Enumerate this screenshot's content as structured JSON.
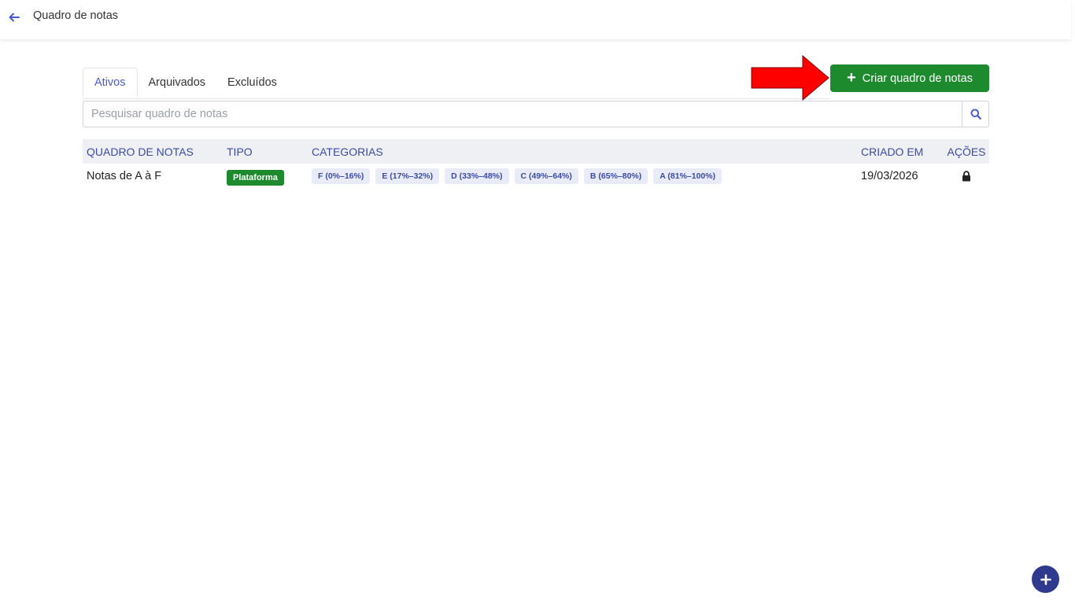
{
  "header": {
    "title": "Quadro de notas"
  },
  "tabs": [
    {
      "label": "Ativos",
      "active": true
    },
    {
      "label": "Arquivados",
      "active": false
    },
    {
      "label": "Excluídos",
      "active": false
    }
  ],
  "actions": {
    "create_label": "Criar quadro de notas"
  },
  "search": {
    "placeholder": "Pesquisar quadro de notas",
    "value": ""
  },
  "table": {
    "headers": {
      "name": "QUADRO DE NOTAS",
      "type": "TIPO",
      "categories": "CATEGORIAS",
      "created": "CRIADO EM",
      "actions": "AÇÕES"
    },
    "rows": [
      {
        "name": "Notas de A à F",
        "type": "Plataforma",
        "categories": [
          "F (0%–16%)",
          "E (17%–32%)",
          "D (33%–48%)",
          "C (49%–64%)",
          "B (65%–80%)",
          "A (81%–100%)"
        ],
        "created": "19/03/2026",
        "action_icon": "lock-icon"
      }
    ]
  },
  "colors": {
    "accent": "#4a5bd4",
    "primary_button": "#1e8a2e",
    "header_text": "#3c4aa8",
    "fab": "#2f3a8f",
    "annotation_arrow": "#ff0000"
  }
}
